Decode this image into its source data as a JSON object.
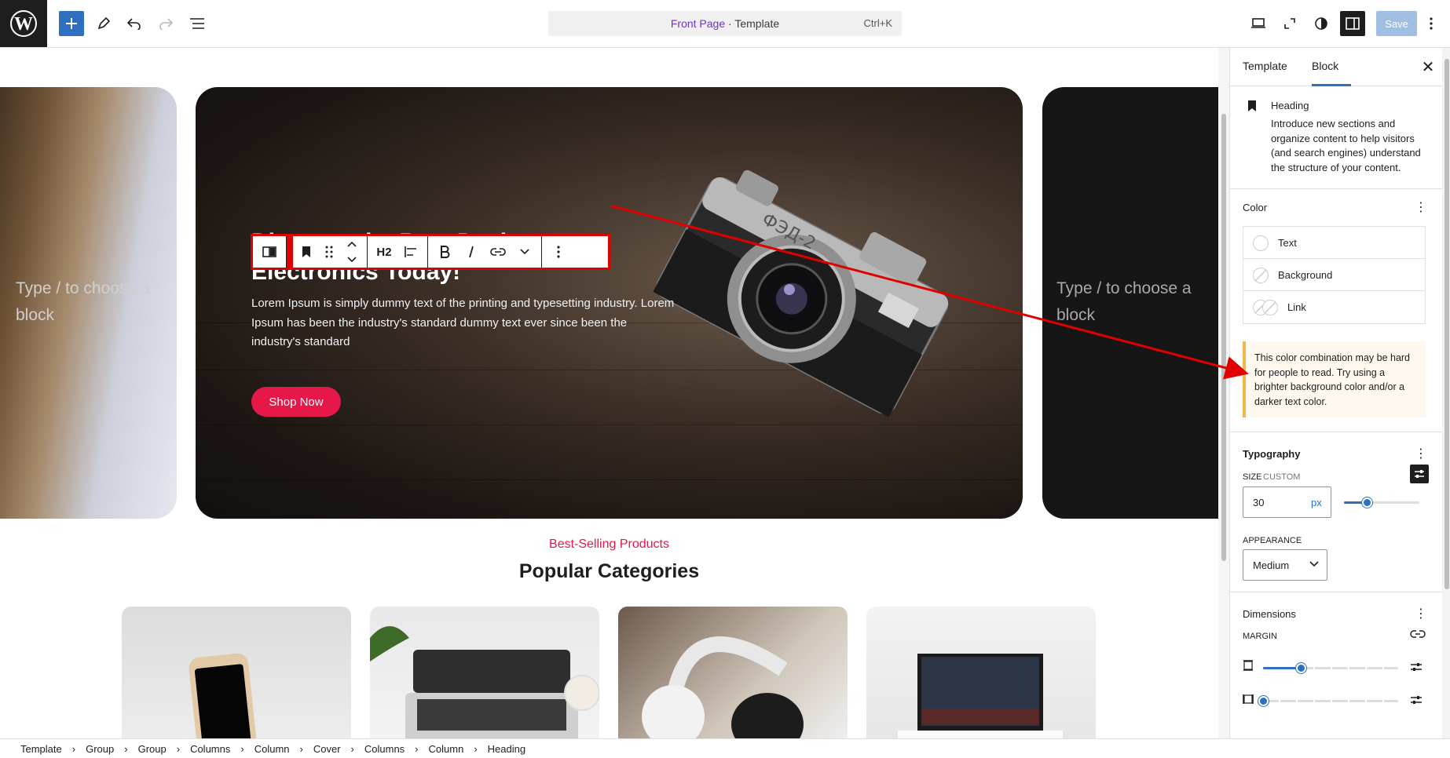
{
  "topbar": {
    "command_bar": {
      "page": "Front Page",
      "separator": " · ",
      "type": "Template",
      "shortcut": "Ctrl+K"
    },
    "save_label": "Save"
  },
  "canvas": {
    "left_slide_placeholder": "Type / to choose a block",
    "right_slide_placeholder": "Type / to choose a block",
    "hero": {
      "heading": "Discover the Best Deals on Electronics Today!",
      "text": "Lorem Ipsum is simply dummy text of the printing and typesetting industry. Lorem Ipsum has been the industry's standard dummy text ever since been the industry's standard",
      "button": "Shop Now"
    },
    "block_toolbar": {
      "heading_level": "H2"
    },
    "section": {
      "subtitle": "Best-Selling Products",
      "title": "Popular Categories"
    }
  },
  "sidebar": {
    "tabs": [
      "Template",
      "Block"
    ],
    "active_tab": "Block",
    "block": {
      "title": "Heading",
      "description": "Introduce new sections and organize content to help visitors (and search engines) understand the structure of your content."
    },
    "color": {
      "title": "Color",
      "items": [
        "Text",
        "Background",
        "Link"
      ],
      "notice": "This color combination may be hard for people to read. Try using a brighter background color and/or a darker text color."
    },
    "typography": {
      "title": "Typography",
      "size_label": "SIZE",
      "size_mode": "CUSTOM",
      "size_value": "30",
      "size_unit": "px",
      "size_slider_fraction": 0.3,
      "appearance_label": "APPEARANCE",
      "appearance_value": "Medium"
    },
    "dimensions": {
      "title": "Dimensions",
      "margin_label": "MARGIN",
      "margin_vertical_fraction": 0.28,
      "margin_horizontal_fraction": 0.0
    }
  },
  "breadcrumb": [
    "Template",
    "Group",
    "Group",
    "Columns",
    "Column",
    "Cover",
    "Columns",
    "Column",
    "Heading"
  ],
  "colors": {
    "accent": "#2f6fbf",
    "brand_red": "#e6184a",
    "annotation": "#e00000"
  }
}
